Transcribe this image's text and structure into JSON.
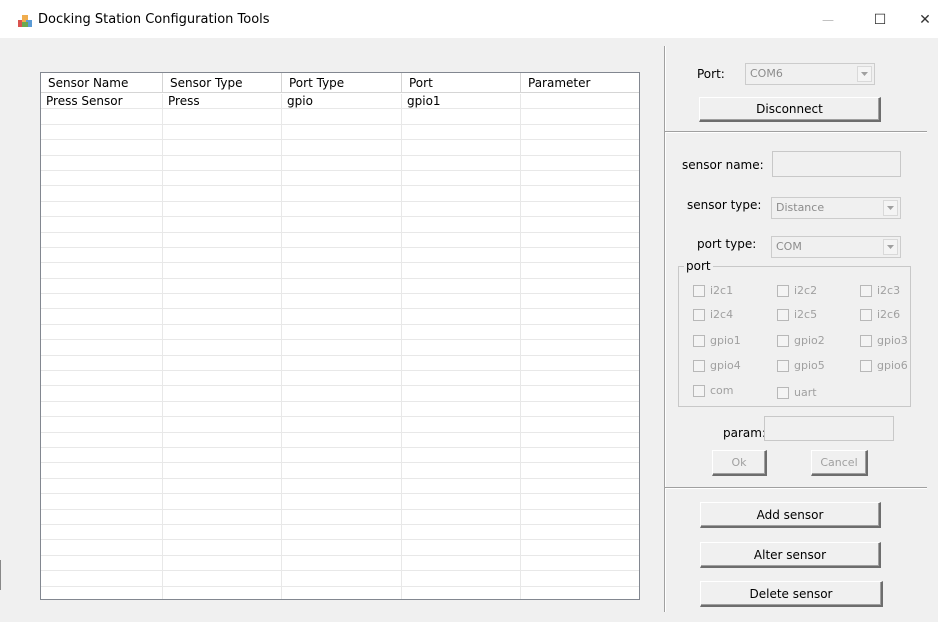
{
  "window": {
    "title": "Docking Station Configuration Tools",
    "minimize_glyph": "—",
    "maximize_glyph": "☐",
    "close_glyph": "✕"
  },
  "table": {
    "columns": [
      "Sensor Name",
      "Sensor Type",
      "Port Type",
      "Port",
      "Parameter"
    ],
    "rows": [
      [
        "Press Sensor",
        "Press",
        "gpio",
        "gpio1",
        ""
      ]
    ]
  },
  "connection": {
    "port_label": "Port:",
    "port_value": "COM6",
    "disconnect_label": "Disconnect"
  },
  "form": {
    "sensor_name_label": "sensor name:",
    "sensor_name_value": "",
    "sensor_type_label": "sensor type:",
    "sensor_type_value": "Distance",
    "port_type_label": "port type:",
    "port_type_value": "COM",
    "port_group_label": "port",
    "ports": [
      {
        "label": "i2c1",
        "checked": false
      },
      {
        "label": "i2c2",
        "checked": false
      },
      {
        "label": "i2c3",
        "checked": false
      },
      {
        "label": "i2c4",
        "checked": false
      },
      {
        "label": "i2c5",
        "checked": false
      },
      {
        "label": "i2c6",
        "checked": false
      },
      {
        "label": "gpio1",
        "checked": false
      },
      {
        "label": "gpio2",
        "checked": false
      },
      {
        "label": "gpio3",
        "checked": false
      },
      {
        "label": "gpio4",
        "checked": false
      },
      {
        "label": "gpio5",
        "checked": false
      },
      {
        "label": "gpio6",
        "checked": false
      },
      {
        "label": "com",
        "checked": false
      },
      {
        "label": "uart",
        "checked": false
      }
    ],
    "param_label": "param:",
    "param_value": "",
    "ok_label": "Ok",
    "cancel_label": "Cancel"
  },
  "actions": {
    "add_label": "Add sensor",
    "alter_label": "Alter sensor",
    "delete_label": "Delete sensor"
  },
  "icons": {
    "app": "app-icon",
    "dropdown": "chevron-down-icon"
  },
  "colors": {
    "background": "#f0f0f0",
    "disabled_text": "#a0a0a0",
    "grid_line": "#e8e8e8"
  }
}
